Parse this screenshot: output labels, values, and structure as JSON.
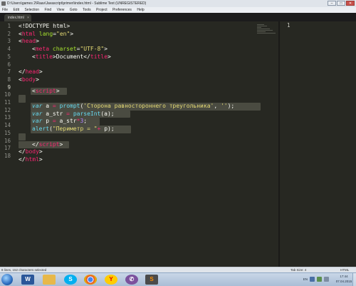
{
  "window": {
    "title": "D:\\Users\\games 2\\Raav\\Javascript\\primeri\\index.html - Sublime Text (UNREGISTERED)",
    "minimize": "–",
    "maximize": "□",
    "close": "✕"
  },
  "menu": [
    "File",
    "Edit",
    "Selection",
    "Find",
    "View",
    "Goto",
    "Tools",
    "Project",
    "Preferences",
    "Help"
  ],
  "tab": {
    "label": "index.html",
    "close": "×"
  },
  "editor": {
    "line_numbers": [
      "1",
      "2",
      "3",
      "4",
      "5",
      "6",
      "7",
      "8",
      "9",
      "10",
      "11",
      "12",
      "13",
      "14",
      "15",
      "16",
      "17",
      "18"
    ],
    "active_line": "9"
  },
  "code": {
    "l1": {
      "a": "<!DOCTYPE html>"
    },
    "l2": {
      "a": "<",
      "b": "html",
      "c": " lang",
      "d": "=",
      "e": "\"en\"",
      "f": ">"
    },
    "l3": {
      "a": "<",
      "b": "head",
      "c": ">"
    },
    "l4": {
      "a": "<",
      "b": "meta",
      "c": " charset",
      "d": "=",
      "e": "\"UTF-8\"",
      "f": ">"
    },
    "l5": {
      "a": "<",
      "b": "title",
      "c": ">",
      "d": "Document",
      "e": "</",
      "f": "title",
      "g": ">"
    },
    "l7": {
      "a": "</",
      "b": "head",
      "c": ">"
    },
    "l8": {
      "a": "<",
      "b": "body",
      "c": ">"
    },
    "l9": {
      "a": "<",
      "b": "script",
      "c": ">"
    },
    "l11": {
      "a": "var",
      "b": " a ",
      "c": "=",
      "d": " ",
      "e": "prompt",
      "f": "(",
      "g": "'Сторона равностороннего треугольника'",
      "h": ", ",
      "i": "''",
      "j": ");"
    },
    "l12": {
      "a": "var",
      "b": " a_str ",
      "c": "=",
      "d": " ",
      "e": "parseInt",
      "f": "(a);"
    },
    "l13": {
      "a": "var",
      "b": " p ",
      "c": "=",
      "d": " a_str",
      "e": "*",
      "f": "3",
      "g": ";"
    },
    "l14": {
      "a": "alert",
      "b": "(",
      "c": "\"Периметр = \"",
      "d": "+",
      "e": " p);"
    },
    "l16": {
      "a": "</",
      "b": "script",
      "c": ">"
    },
    "l17": {
      "a": "</",
      "b": "body",
      "c": ">"
    },
    "l18": {
      "a": "</",
      "b": "html",
      "c": ">"
    }
  },
  "pane2": {
    "line_number": "1"
  },
  "status": {
    "selection": "8 lines, 152 characters selected",
    "tab_size": "Tab Size: 4",
    "syntax": "HTML"
  },
  "taskbar": {
    "apps": [
      "word-icon",
      "folder-icon",
      "skype-icon",
      "chrome-icon",
      "yandex-icon",
      "viber-icon",
      "sublime-icon"
    ],
    "lang": "EN",
    "time": "17:44",
    "date": "07.04.2015"
  },
  "colors": {
    "editor_bg": "#272822",
    "tag": "#f92672",
    "attr": "#a6e22e",
    "string": "#e6db74",
    "keyword": "#66d9ef",
    "number": "#ae81ff",
    "selection": "#4a4b41"
  }
}
